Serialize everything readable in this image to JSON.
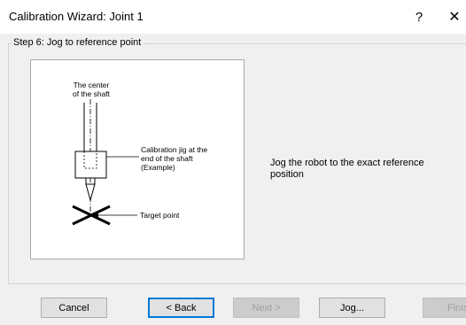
{
  "window": {
    "title": "Calibration Wizard: Joint 1",
    "help_glyph": "?",
    "close_glyph": "✕"
  },
  "step": {
    "caption": "Step 6: Jog to reference point",
    "instruction": "Jog the robot to the exact reference position"
  },
  "diagram": {
    "center_label_line1": "The center",
    "center_label_line2": "of the shaft",
    "jig_label_line1": "Calibration jig at the",
    "jig_label_line2": "end of the shaft",
    "jig_label_line3": "(Example)",
    "target_label": "Target point"
  },
  "buttons": {
    "cancel": "Cancel",
    "back": "< Back",
    "next": "Next >",
    "jog": "Jog...",
    "finish": "Finish"
  },
  "colors": {
    "dialog_bg": "#f0f0f0",
    "default_button_border": "#0078d7",
    "disabled_text": "#a0a0a0"
  }
}
